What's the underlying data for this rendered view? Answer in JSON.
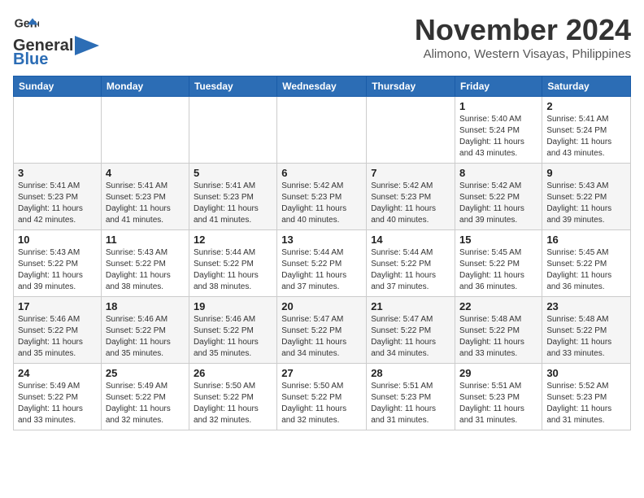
{
  "logo": {
    "name_part1": "General",
    "name_part2": "Blue"
  },
  "header": {
    "month": "November 2024",
    "location": "Alimono, Western Visayas, Philippines"
  },
  "days_of_week": [
    "Sunday",
    "Monday",
    "Tuesday",
    "Wednesday",
    "Thursday",
    "Friday",
    "Saturday"
  ],
  "weeks": [
    {
      "days": [
        {
          "num": "",
          "info": ""
        },
        {
          "num": "",
          "info": ""
        },
        {
          "num": "",
          "info": ""
        },
        {
          "num": "",
          "info": ""
        },
        {
          "num": "",
          "info": ""
        },
        {
          "num": "1",
          "info": "Sunrise: 5:40 AM\nSunset: 5:24 PM\nDaylight: 11 hours\nand 43 minutes."
        },
        {
          "num": "2",
          "info": "Sunrise: 5:41 AM\nSunset: 5:24 PM\nDaylight: 11 hours\nand 43 minutes."
        }
      ]
    },
    {
      "days": [
        {
          "num": "3",
          "info": "Sunrise: 5:41 AM\nSunset: 5:23 PM\nDaylight: 11 hours\nand 42 minutes."
        },
        {
          "num": "4",
          "info": "Sunrise: 5:41 AM\nSunset: 5:23 PM\nDaylight: 11 hours\nand 41 minutes."
        },
        {
          "num": "5",
          "info": "Sunrise: 5:41 AM\nSunset: 5:23 PM\nDaylight: 11 hours\nand 41 minutes."
        },
        {
          "num": "6",
          "info": "Sunrise: 5:42 AM\nSunset: 5:23 PM\nDaylight: 11 hours\nand 40 minutes."
        },
        {
          "num": "7",
          "info": "Sunrise: 5:42 AM\nSunset: 5:23 PM\nDaylight: 11 hours\nand 40 minutes."
        },
        {
          "num": "8",
          "info": "Sunrise: 5:42 AM\nSunset: 5:22 PM\nDaylight: 11 hours\nand 39 minutes."
        },
        {
          "num": "9",
          "info": "Sunrise: 5:43 AM\nSunset: 5:22 PM\nDaylight: 11 hours\nand 39 minutes."
        }
      ]
    },
    {
      "days": [
        {
          "num": "10",
          "info": "Sunrise: 5:43 AM\nSunset: 5:22 PM\nDaylight: 11 hours\nand 39 minutes."
        },
        {
          "num": "11",
          "info": "Sunrise: 5:43 AM\nSunset: 5:22 PM\nDaylight: 11 hours\nand 38 minutes."
        },
        {
          "num": "12",
          "info": "Sunrise: 5:44 AM\nSunset: 5:22 PM\nDaylight: 11 hours\nand 38 minutes."
        },
        {
          "num": "13",
          "info": "Sunrise: 5:44 AM\nSunset: 5:22 PM\nDaylight: 11 hours\nand 37 minutes."
        },
        {
          "num": "14",
          "info": "Sunrise: 5:44 AM\nSunset: 5:22 PM\nDaylight: 11 hours\nand 37 minutes."
        },
        {
          "num": "15",
          "info": "Sunrise: 5:45 AM\nSunset: 5:22 PM\nDaylight: 11 hours\nand 36 minutes."
        },
        {
          "num": "16",
          "info": "Sunrise: 5:45 AM\nSunset: 5:22 PM\nDaylight: 11 hours\nand 36 minutes."
        }
      ]
    },
    {
      "days": [
        {
          "num": "17",
          "info": "Sunrise: 5:46 AM\nSunset: 5:22 PM\nDaylight: 11 hours\nand 35 minutes."
        },
        {
          "num": "18",
          "info": "Sunrise: 5:46 AM\nSunset: 5:22 PM\nDaylight: 11 hours\nand 35 minutes."
        },
        {
          "num": "19",
          "info": "Sunrise: 5:46 AM\nSunset: 5:22 PM\nDaylight: 11 hours\nand 35 minutes."
        },
        {
          "num": "20",
          "info": "Sunrise: 5:47 AM\nSunset: 5:22 PM\nDaylight: 11 hours\nand 34 minutes."
        },
        {
          "num": "21",
          "info": "Sunrise: 5:47 AM\nSunset: 5:22 PM\nDaylight: 11 hours\nand 34 minutes."
        },
        {
          "num": "22",
          "info": "Sunrise: 5:48 AM\nSunset: 5:22 PM\nDaylight: 11 hours\nand 33 minutes."
        },
        {
          "num": "23",
          "info": "Sunrise: 5:48 AM\nSunset: 5:22 PM\nDaylight: 11 hours\nand 33 minutes."
        }
      ]
    },
    {
      "days": [
        {
          "num": "24",
          "info": "Sunrise: 5:49 AM\nSunset: 5:22 PM\nDaylight: 11 hours\nand 33 minutes."
        },
        {
          "num": "25",
          "info": "Sunrise: 5:49 AM\nSunset: 5:22 PM\nDaylight: 11 hours\nand 32 minutes."
        },
        {
          "num": "26",
          "info": "Sunrise: 5:50 AM\nSunset: 5:22 PM\nDaylight: 11 hours\nand 32 minutes."
        },
        {
          "num": "27",
          "info": "Sunrise: 5:50 AM\nSunset: 5:22 PM\nDaylight: 11 hours\nand 32 minutes."
        },
        {
          "num": "28",
          "info": "Sunrise: 5:51 AM\nSunset: 5:23 PM\nDaylight: 11 hours\nand 31 minutes."
        },
        {
          "num": "29",
          "info": "Sunrise: 5:51 AM\nSunset: 5:23 PM\nDaylight: 11 hours\nand 31 minutes."
        },
        {
          "num": "30",
          "info": "Sunrise: 5:52 AM\nSunset: 5:23 PM\nDaylight: 11 hours\nand 31 minutes."
        }
      ]
    }
  ]
}
